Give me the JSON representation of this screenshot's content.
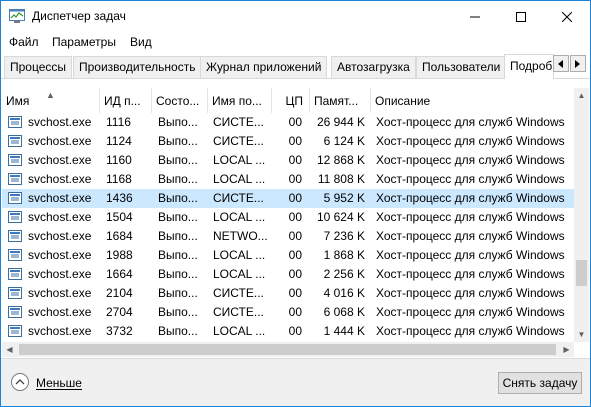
{
  "window": {
    "title": "Диспетчер задач"
  },
  "menu": {
    "file": "Файл",
    "options": "Параметры",
    "view": "Вид"
  },
  "tabs": [
    {
      "label": "Процессы",
      "active": false
    },
    {
      "label": "Производительность",
      "active": false
    },
    {
      "label": "Журнал приложений",
      "active": false
    },
    {
      "label": "Автозагрузка",
      "active": false
    },
    {
      "label": "Пользователи",
      "active": false
    },
    {
      "label": "Подробн",
      "active": true
    }
  ],
  "table": {
    "columns": [
      "Имя",
      "ИД п...",
      "Состо...",
      "Имя по...",
      "ЦП",
      "Памят...",
      "Описание"
    ],
    "rows": [
      {
        "name": "svchost.exe",
        "pid": "1116",
        "status": "Выпо...",
        "user": "СИСТЕ...",
        "cpu": "00",
        "memory": "26 944 K",
        "description": "Хост-процесс для служб Windows",
        "selected": false
      },
      {
        "name": "svchost.exe",
        "pid": "1124",
        "status": "Выпо...",
        "user": "СИСТЕ...",
        "cpu": "00",
        "memory": "6 124 K",
        "description": "Хост-процесс для служб Windows",
        "selected": false
      },
      {
        "name": "svchost.exe",
        "pid": "1160",
        "status": "Выпо...",
        "user": "LOCAL ...",
        "cpu": "00",
        "memory": "12 868 K",
        "description": "Хост-процесс для служб Windows",
        "selected": false
      },
      {
        "name": "svchost.exe",
        "pid": "1168",
        "status": "Выпо...",
        "user": "LOCAL ...",
        "cpu": "00",
        "memory": "11 808 K",
        "description": "Хост-процесс для служб Windows",
        "selected": false
      },
      {
        "name": "svchost.exe",
        "pid": "1436",
        "status": "Выпо...",
        "user": "СИСТЕ...",
        "cpu": "00",
        "memory": "5 952 K",
        "description": "Хост-процесс для служб Windows",
        "selected": true
      },
      {
        "name": "svchost.exe",
        "pid": "1504",
        "status": "Выпо...",
        "user": "LOCAL ...",
        "cpu": "00",
        "memory": "10 624 K",
        "description": "Хост-процесс для служб Windows",
        "selected": false
      },
      {
        "name": "svchost.exe",
        "pid": "1684",
        "status": "Выпо...",
        "user": "NETWO...",
        "cpu": "00",
        "memory": "7 236 K",
        "description": "Хост-процесс для служб Windows",
        "selected": false
      },
      {
        "name": "svchost.exe",
        "pid": "1988",
        "status": "Выпо...",
        "user": "LOCAL ...",
        "cpu": "00",
        "memory": "1 868 K",
        "description": "Хост-процесс для служб Windows",
        "selected": false
      },
      {
        "name": "svchost.exe",
        "pid": "1664",
        "status": "Выпо...",
        "user": "LOCAL ...",
        "cpu": "00",
        "memory": "2 256 K",
        "description": "Хост-процесс для служб Windows",
        "selected": false
      },
      {
        "name": "svchost.exe",
        "pid": "2104",
        "status": "Выпо...",
        "user": "СИСТЕ...",
        "cpu": "00",
        "memory": "4 016 K",
        "description": "Хост-процесс для служб Windows",
        "selected": false
      },
      {
        "name": "svchost.exe",
        "pid": "2704",
        "status": "Выпо...",
        "user": "СИСТЕ...",
        "cpu": "00",
        "memory": "6 068 K",
        "description": "Хост-процесс для служб Windows",
        "selected": false
      },
      {
        "name": "svchost.exe",
        "pid": "3732",
        "status": "Выпо...",
        "user": "LOCAL ...",
        "cpu": "00",
        "memory": "1 444 K",
        "description": "Хост-процесс для служб Windows",
        "selected": false
      }
    ]
  },
  "footer": {
    "fewer_details": "Меньше",
    "end_task": "Снять задачу"
  },
  "colors": {
    "selection": "#cce8ff",
    "window_border": "#1883d7"
  },
  "icons": {
    "app": "task-manager-icon",
    "process": "service-host-icon",
    "fewer": "chevron-up-circle-icon"
  }
}
